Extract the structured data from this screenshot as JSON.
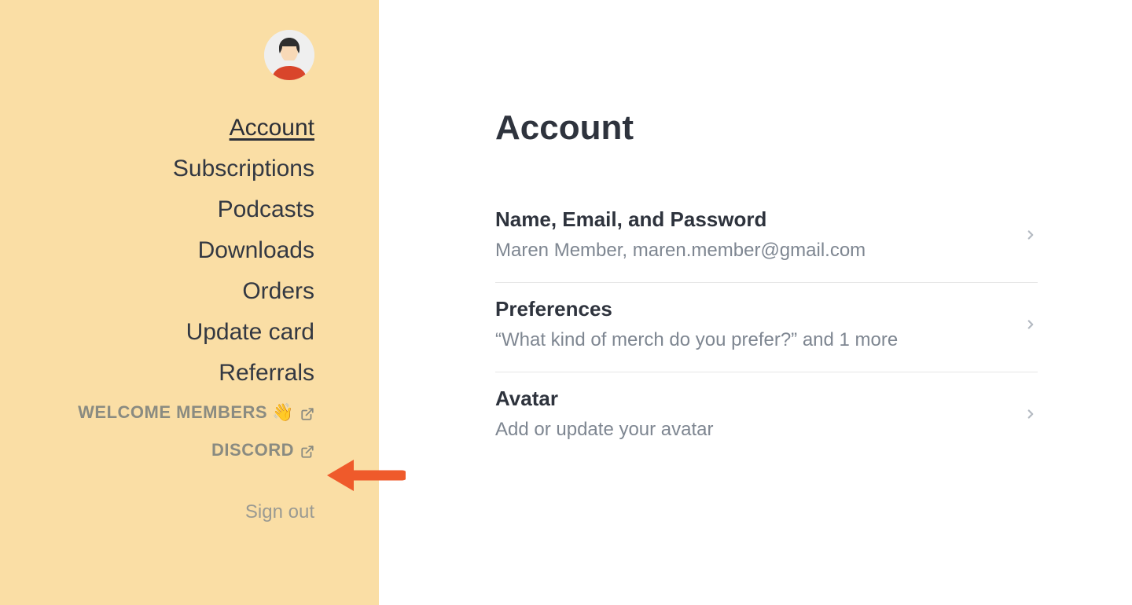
{
  "sidebar": {
    "nav": [
      {
        "label": "Account",
        "active": true
      },
      {
        "label": "Subscriptions",
        "active": false
      },
      {
        "label": "Podcasts",
        "active": false
      },
      {
        "label": "Downloads",
        "active": false
      },
      {
        "label": "Orders",
        "active": false
      },
      {
        "label": "Update card",
        "active": false
      },
      {
        "label": "Referrals",
        "active": false
      }
    ],
    "external": [
      {
        "label": "WELCOME MEMBERS",
        "emoji": "👋"
      },
      {
        "label": "DISCORD"
      }
    ],
    "signout_label": "Sign out"
  },
  "page": {
    "title": "Account",
    "rows": [
      {
        "title": "Name, Email, and Password",
        "subtitle": "Maren Member, maren.member@gmail.com"
      },
      {
        "title": "Preferences",
        "subtitle": "“What kind of merch do you prefer?” and 1 more"
      },
      {
        "title": "Avatar",
        "subtitle": "Add or update your avatar"
      }
    ]
  },
  "annotation": {
    "arrow_points_to": "DISCORD",
    "arrow_color": "#ef5a2b"
  }
}
